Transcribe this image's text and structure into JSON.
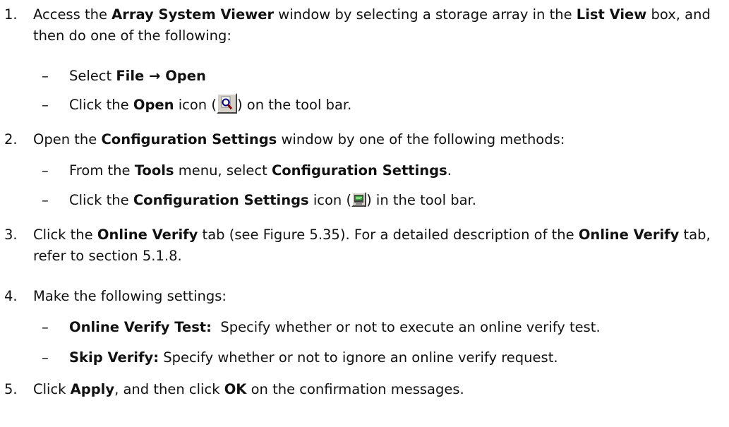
{
  "steps": [
    {
      "num": "1.",
      "parts": [
        "Access the ",
        "Array System Viewer",
        " window by selecting a storage array in the ",
        "List View",
        " box, and then do one of the following:"
      ],
      "subs": [
        {
          "parts": [
            "Select ",
            "File → Open"
          ]
        },
        {
          "parts": [
            "Click the ",
            "Open",
            " icon (",
            ") on the tool bar."
          ],
          "icon": "open-magnifier-icon"
        }
      ]
    },
    {
      "num": "2.",
      "parts": [
        "Open the ",
        "Configuration Settings",
        " window by one of the following methods:"
      ],
      "subs": [
        {
          "parts": [
            "From the ",
            "Tools",
            " menu, select ",
            "Configuration Settings",
            "."
          ]
        },
        {
          "parts": [
            "Click the ",
            "Configuration Settings",
            " icon (",
            ") in the tool bar."
          ],
          "icon": "configuration-settings-icon"
        }
      ]
    },
    {
      "num": "3.",
      "parts": [
        "Click the ",
        "Online Verify",
        " tab (see Figure 5.35). For a detailed description of the ",
        "Online Verify",
        " tab, refer to section 5.1.8."
      ],
      "subs": []
    },
    {
      "num": "4.",
      "parts": [
        "Make the following settings:"
      ],
      "subs": [
        {
          "parts": [
            "Online Verify Test:",
            "  Specify whether or not to execute an online verify test."
          ]
        },
        {
          "parts": [
            "Skip Verify:",
            " Specify whether or not to ignore an online verify request."
          ]
        }
      ]
    },
    {
      "num": "5.",
      "parts": [
        "Click ",
        "Apply",
        ", and then click ",
        "OK",
        " on the confirmation messages."
      ],
      "subs": []
    }
  ],
  "dash_glyph": "–"
}
